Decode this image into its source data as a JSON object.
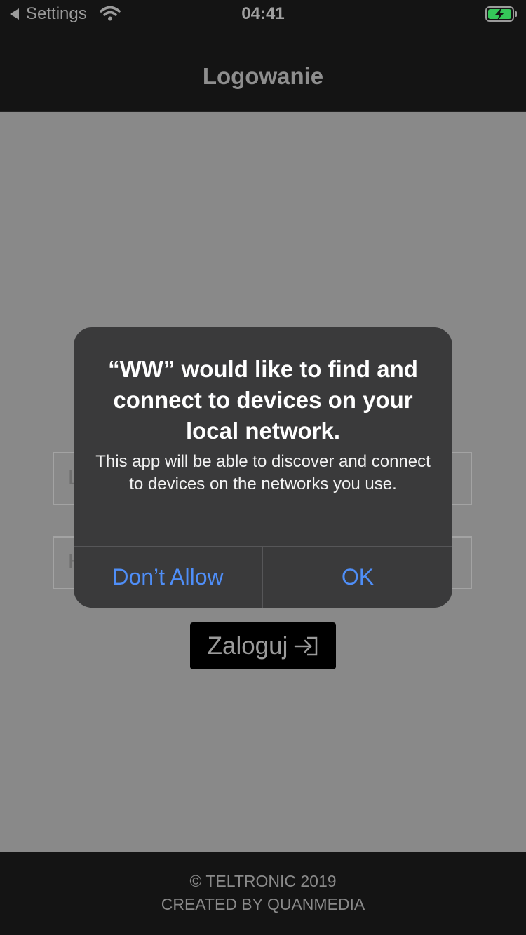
{
  "status_bar": {
    "back_label": "Settings",
    "time": "04:41"
  },
  "header": {
    "title": "Logowanie"
  },
  "form": {
    "login_placeholder": "L",
    "password_placeholder": "H",
    "login_button_label": "Zaloguj"
  },
  "dialog": {
    "title": "“WW” would like to find and connect to devices on your local network.",
    "message": "This app will be able to discover and connect to devices on the networks you use.",
    "deny_label": "Don’t Allow",
    "ok_label": "OK"
  },
  "footer": {
    "copyright": "© TELTRONIC 2019",
    "credit": "CREATED BY QUANMEDIA"
  },
  "colors": {
    "dialog_button": "#4f8ef7",
    "battery": "#35c759",
    "bar_background": "#141414",
    "backdrop": "#898989"
  },
  "icons": [
    "back-arrow-icon",
    "wifi-icon",
    "battery-charging-icon",
    "login-arrow-icon"
  ]
}
